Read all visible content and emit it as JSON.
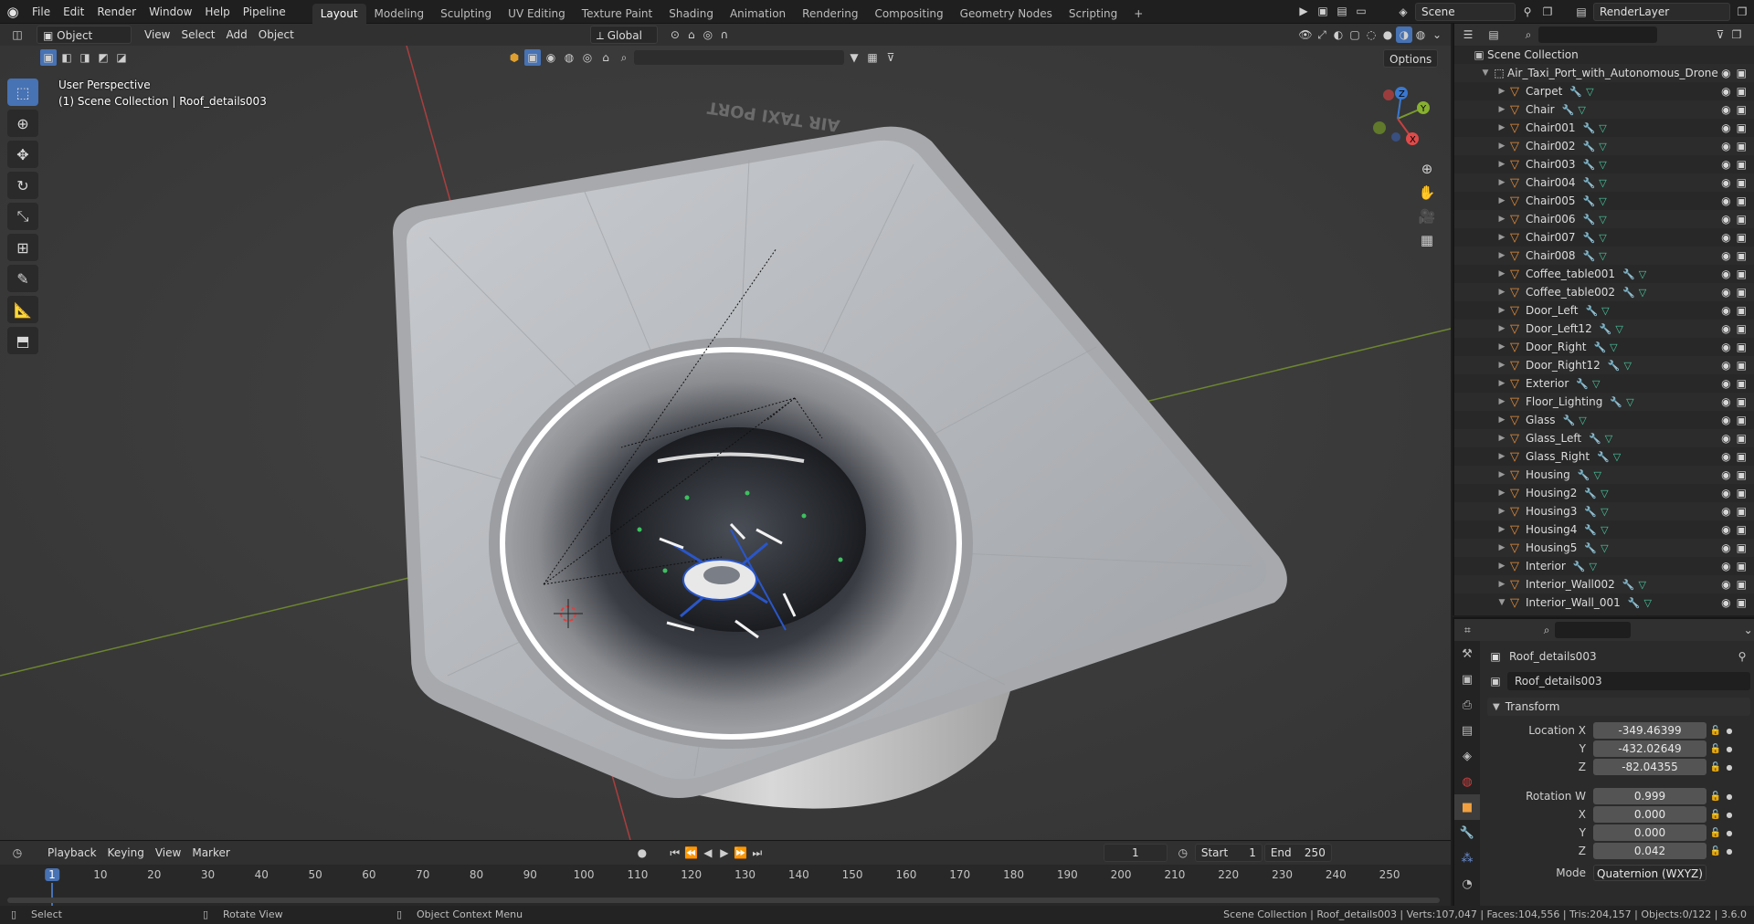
{
  "topbar": {
    "menus": [
      "File",
      "Edit",
      "Render",
      "Window",
      "Help",
      "Pipeline"
    ],
    "workspaces": [
      "Layout",
      "Modeling",
      "Sculpting",
      "UV Editing",
      "Texture Paint",
      "Shading",
      "Animation",
      "Rendering",
      "Compositing",
      "Geometry Nodes",
      "Scripting"
    ],
    "active_workspace": "Layout",
    "scene_name": "Scene",
    "view_layer": "RenderLayer"
  },
  "viewport_header": {
    "mode": "Object Mode",
    "menus": [
      "View",
      "Select",
      "Add",
      "Object"
    ],
    "transform_orientation": "Global",
    "options_label": "Options"
  },
  "viewport": {
    "perspective_label": "User Perspective",
    "context_label": "(1) Scene Collection | Roof_details003",
    "decal_text": "AIR TAXI PORT"
  },
  "outliner": {
    "root": "Scene Collection",
    "collection": "Air_Taxi_Port_with_Autonomous_Drone",
    "items": [
      "Carpet",
      "Chair",
      "Chair001",
      "Chair002",
      "Chair003",
      "Chair004",
      "Chair005",
      "Chair006",
      "Chair007",
      "Chair008",
      "Coffee_table001",
      "Coffee_table002",
      "Door_Left",
      "Door_Left12",
      "Door_Right",
      "Door_Right12",
      "Exterior",
      "Floor_Lighting",
      "Glass",
      "Glass_Left",
      "Glass_Right",
      "Housing",
      "Housing2",
      "Housing3",
      "Housing4",
      "Housing5",
      "Interior",
      "Interior_Wall002",
      "Interior_Wall_001"
    ]
  },
  "properties": {
    "object_name": "Roof_details003",
    "data_name": "Roof_details003",
    "panel_title": "Transform",
    "location_label": "Location X",
    "loc_x": "-349.46399",
    "loc_y": "-432.02649",
    "loc_z": "-82.04355",
    "rotation_label": "Rotation W",
    "rot_w": "0.999",
    "rot_x": "0.000",
    "rot_y": "0.000",
    "rot_z": "0.042",
    "y_label": "Y",
    "z_label": "Z",
    "x_label": "X",
    "mode_label": "Mode",
    "mode_value": "Quaternion (WXYZ)"
  },
  "timeline": {
    "menus": [
      "Playback",
      "Keying",
      "View",
      "Marker"
    ],
    "current_frame": "1",
    "start_label": "Start",
    "start": "1",
    "end_label": "End",
    "end": "250",
    "ticks": [
      "1",
      "10",
      "20",
      "30",
      "40",
      "50",
      "60",
      "70",
      "80",
      "90",
      "100",
      "110",
      "120",
      "130",
      "140",
      "150",
      "160",
      "170",
      "180",
      "190",
      "200",
      "210",
      "220",
      "230",
      "240",
      "250"
    ]
  },
  "statusbar": {
    "select": "Select",
    "rotate": "Rotate View",
    "context_menu": "Object Context Menu",
    "stats": "Scene Collection | Roof_details003 | Verts:107,047 | Faces:104,556 | Tris:204,157 | Objects:0/122 | 3.6.0"
  },
  "colors": {
    "accent": "#4772b3",
    "object_orange": "#e88f3a",
    "axis_red": "#c74040",
    "axis_green": "#7a9a2e"
  }
}
